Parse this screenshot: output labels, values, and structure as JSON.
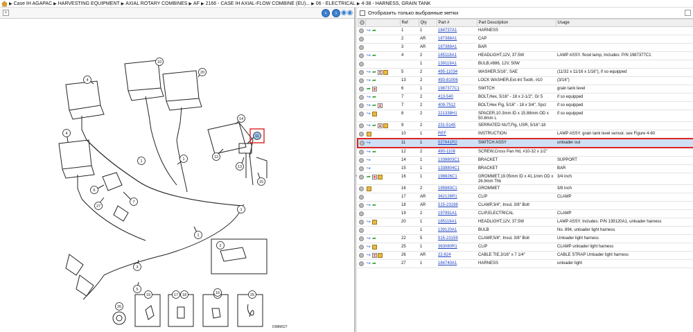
{
  "breadcrumb": {
    "items": [
      "Case IH AGAPAC",
      "HARVESTING EQUIPMENT",
      "AXIAL ROTARY COMBINES",
      "AF",
      "2166 - CASE IH AXIAL-FLOW COMBINE (EU)...",
      "06 - ELECTRICAL",
      "4-38 - HARNESS, GRAIN TANK"
    ]
  },
  "filter": {
    "label": "Отобразить только выбранные метки"
  },
  "diagram": {
    "code": "D98M027",
    "callouts": [
      "10",
      "20",
      "4",
      "4",
      "14",
      "11",
      "12",
      "13",
      "15",
      "7",
      "6",
      "27",
      "1",
      "1",
      "1",
      "1",
      "3",
      "5",
      "2",
      "19",
      "17",
      "18",
      "22",
      "25",
      "26",
      "16"
    ]
  },
  "table": {
    "headers": [
      "Ref",
      "Qty",
      "Part #",
      "Part Description",
      "Usage"
    ],
    "rows": [
      {
        "ref": "1",
        "qty": "1",
        "part": "184737A1",
        "desc": "HARNESS",
        "usage": "",
        "icons": [
          "blue",
          "green"
        ]
      },
      {
        "ref": "2",
        "qty": "AR",
        "part": "187388A1",
        "desc": "CAP",
        "usage": "",
        "icons": []
      },
      {
        "ref": "3",
        "qty": "AR",
        "part": "187389A1",
        "desc": "BAR",
        "usage": "",
        "icons": []
      },
      {
        "ref": "4",
        "qty": "2",
        "part": "185118A1",
        "desc": "HEADLIGHT,12V, 37.5W",
        "usage": "LAMP ASSY. flood lamp, Includes: P/N 1987377C1",
        "icons": [
          "blue",
          "green"
        ]
      },
      {
        "ref": "",
        "qty": "1",
        "part": "139119A1",
        "desc": "BULB,#886, 12V, 50W",
        "usage": "",
        "icons": []
      },
      {
        "ref": "5",
        "qty": "2",
        "part": "495-11034",
        "desc": "WASHER,5/16\", SAE",
        "usage": "(11/32 x 11/16 x 1/16\"), if so equipped",
        "icons": [
          "blue",
          "green",
          "doc",
          "box"
        ]
      },
      {
        "ref": "13",
        "qty": "2",
        "part": "493-81006",
        "desc": "LOCK WASHER,Ext-Int Tooth, #10",
        "usage": "(3/16\")",
        "icons": [
          "blue",
          "green"
        ]
      },
      {
        "ref": "6",
        "qty": "1",
        "part": "1987377C1",
        "desc": "SWITCH",
        "usage": "grain tank level",
        "icons": [
          "green",
          "doc"
        ]
      },
      {
        "ref": "7",
        "qty": "2",
        "part": "413-540",
        "desc": "BOLT,Hex, 5/16\" - 18 x 2-1/2\", Gr 5",
        "usage": "if so equipped",
        "icons": [
          "blue",
          "green"
        ]
      },
      {
        "ref": "7",
        "qty": "2",
        "part": "409-7512",
        "desc": "BOLT,Hex Flg, 5/16\" - 18 x 3/4\", Spcl",
        "usage": "if so equipped",
        "icons": [
          "blue",
          "green",
          "doc"
        ]
      },
      {
        "ref": "8",
        "qty": "2",
        "part": "221338H1",
        "desc": "SPACER,10.3mm ID x 15.88mm OD x 50.8mm L",
        "usage": "if so equipped",
        "icons": [
          "blue",
          "box"
        ],
        "tall": true
      },
      {
        "ref": "9",
        "qty": "2",
        "part": "231-5145",
        "desc": "SERRATED NUT,Flg, USR, 5/16\"-18",
        "usage": "",
        "icons": [
          "blue",
          "green",
          "doc",
          "box"
        ]
      },
      {
        "ref": "10",
        "qty": "1",
        "part": "REF",
        "desc": "INSTRUCTION",
        "usage": "LAMP ASSY. grain tank level sensor, see Figure 4-60",
        "icons": [
          "box"
        ]
      },
      {
        "ref": "11",
        "qty": "1",
        "part": "537641R2",
        "desc": "SWITCH ASSY",
        "usage": "unloader out",
        "icons": [
          "blue"
        ],
        "selected": true
      },
      {
        "ref": "12",
        "qty": "2",
        "part": "490-1108",
        "desc": "SCREW,Cross Pan Hd, #10-32 x 1/2\"",
        "usage": "",
        "icons": [
          "blue",
          "green"
        ]
      },
      {
        "ref": "14",
        "qty": "1",
        "part": "1338803C1",
        "desc": "BRACKET",
        "usage": "SUPPORT",
        "icons": [
          "blue"
        ]
      },
      {
        "ref": "15",
        "qty": "1",
        "part": "1338804C1",
        "desc": "BRACKET",
        "usage": "BAR",
        "icons": [
          "blue"
        ]
      },
      {
        "ref": "16",
        "qty": "1",
        "part": "198826C1",
        "desc": "GROMMET,19.05mm ID x 41.1mm OD x 26.9mm Thk",
        "usage": "3/4 inch",
        "icons": [
          "green",
          "doc",
          "box"
        ],
        "tall": true
      },
      {
        "ref": "16",
        "qty": "2",
        "part": "195883C1",
        "desc": "GROMMET",
        "usage": "3/8 inch",
        "icons": [
          "box"
        ]
      },
      {
        "ref": "17",
        "qty": "AR",
        "part": "362126R1",
        "desc": "CLIP",
        "usage": "CLAMP",
        "icons": []
      },
      {
        "ref": "18",
        "qty": "AR",
        "part": "515-23198",
        "desc": "CLAMP,3/4\", Insul, 3/8\" Bolt",
        "usage": "",
        "icons": [
          "blue",
          "green"
        ]
      },
      {
        "ref": "19",
        "qty": "2",
        "part": "197991A1",
        "desc": "CLIP,ELECTRICAL",
        "usage": "CLAMP",
        "icons": []
      },
      {
        "ref": "20",
        "qty": "1",
        "part": "185116A1",
        "desc": "HEADLIGHT,12V, 37.5W",
        "usage": "LAMP ASSY. Includes: P/N 139120A1, unloader harness",
        "icons": [
          "blue",
          "box"
        ]
      },
      {
        "ref": "",
        "qty": "1",
        "part": "139120A1",
        "desc": "BULB",
        "usage": "No. 894, unloader light harness",
        "icons": []
      },
      {
        "ref": "22",
        "qty": "5",
        "part": "515-23159",
        "desc": "CLAMP,5/8\", Insul, 3/8\" Bolt",
        "usage": "Unloader light harness",
        "icons": [
          "blue",
          "green"
        ]
      },
      {
        "ref": "25",
        "qty": "1",
        "part": "363080R1",
        "desc": "CLIP",
        "usage": "CLAMP unloader light harness",
        "icons": [
          "blue",
          "box"
        ]
      },
      {
        "ref": "26",
        "qty": "AR",
        "part": "22-824",
        "desc": "CABLE TIE,3/16\" x 7 1/4\"",
        "usage": "CABLE STRAP Unloader light harness",
        "icons": [
          "blue",
          "doc",
          "box"
        ]
      },
      {
        "ref": "27",
        "qty": "1",
        "part": "184740A1",
        "desc": "HARNESS",
        "usage": "unloader light",
        "icons": [
          "blue",
          "green"
        ]
      }
    ]
  }
}
